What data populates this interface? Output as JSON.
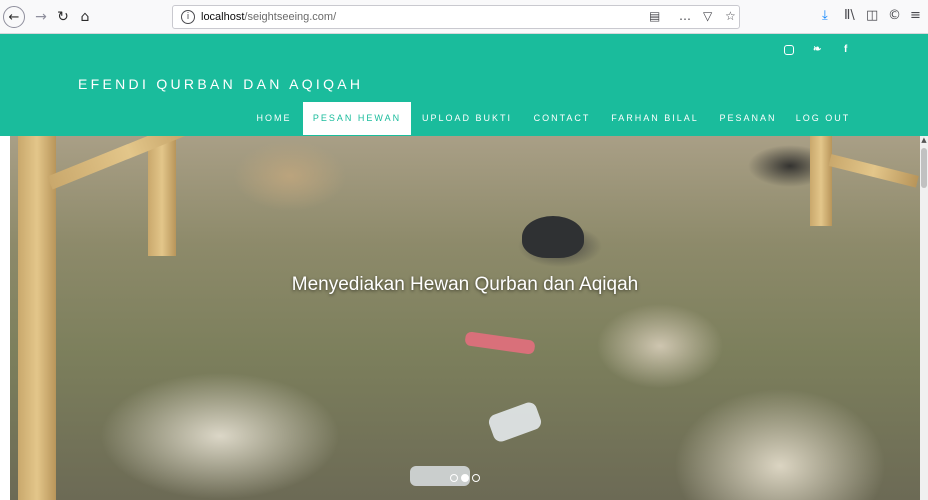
{
  "browser": {
    "url_host": "localhost",
    "url_path": "/seightseeing.com/",
    "icons": {
      "back": "←",
      "forward": "→",
      "reload": "↻",
      "home": "⌂",
      "info": "i",
      "reader": "▤",
      "more": "…",
      "pocket": "▽",
      "star": "☆",
      "download": "⤓",
      "library": "Ⅱ\\",
      "sidebar": "◫",
      "extension": "©",
      "menu": "≡"
    }
  },
  "header": {
    "brand": "EFENDI QURBAN DAN AQIQAH",
    "social": {
      "twitter": "❧",
      "facebook": "f"
    },
    "nav": [
      {
        "label": "HOME",
        "active": false
      },
      {
        "label": "PESAN HEWAN",
        "active": true
      },
      {
        "label": "UPLOAD BUKTI",
        "active": false
      },
      {
        "label": "CONTACT",
        "active": false
      },
      {
        "label": "FARHAN BILAL",
        "active": false
      },
      {
        "label": "PESANAN",
        "active": false
      },
      {
        "label": "LOG OUT",
        "active": false
      }
    ]
  },
  "hero": {
    "caption": "Menyediakan Hewan Qurban dan Aqiqah",
    "slides_total": 3,
    "active_slide": 2
  },
  "colors": {
    "accent": "#1abc9c",
    "nav_active_bg": "#ffffff",
    "text_on_accent": "#ffffff"
  }
}
